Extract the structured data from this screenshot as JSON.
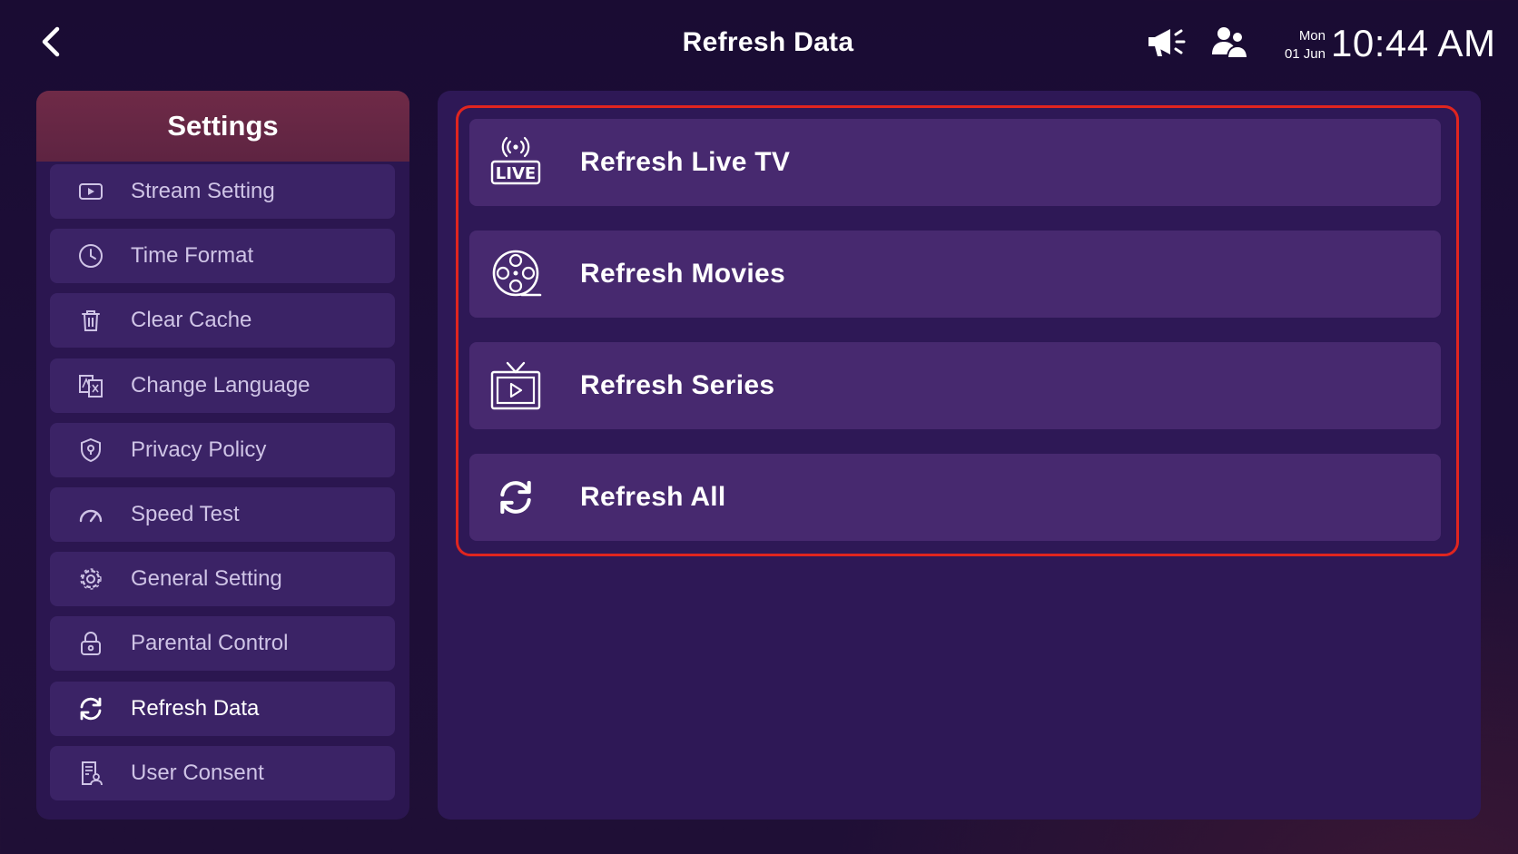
{
  "header": {
    "title": "Refresh Data",
    "date_day": "Mon",
    "date_date": "01 Jun",
    "time": "10:44 AM"
  },
  "icons": {
    "back": "chevron-left-icon",
    "announcement": "megaphone-icon",
    "users": "users-icon"
  },
  "sidebar": {
    "title": "Settings",
    "items": [
      {
        "label": "Stream Setting",
        "icon": "play-icon"
      },
      {
        "label": "Time Format",
        "icon": "clock-icon"
      },
      {
        "label": "Clear Cache",
        "icon": "trash-icon"
      },
      {
        "label": "Change Language",
        "icon": "translate-icon"
      },
      {
        "label": "Privacy Policy",
        "icon": "shield-icon"
      },
      {
        "label": "Speed Test",
        "icon": "speedometer-icon"
      },
      {
        "label": "General Setting",
        "icon": "gear-icon"
      },
      {
        "label": "Parental Control",
        "icon": "lock-icon"
      },
      {
        "label": "Refresh Data",
        "icon": "refresh-icon",
        "active": true
      },
      {
        "label": "User Consent",
        "icon": "document-user-icon"
      }
    ]
  },
  "main": {
    "items": [
      {
        "label": "Refresh Live TV",
        "icon": "live-tv-icon"
      },
      {
        "label": "Refresh Movies",
        "icon": "film-reel-icon"
      },
      {
        "label": "Refresh Series",
        "icon": "tv-play-icon"
      },
      {
        "label": "Refresh All",
        "icon": "refresh-icon"
      }
    ]
  },
  "colors": {
    "accent_red": "#e0251f",
    "sidebar_header": "#6f2a47",
    "item_bg": "#47296f",
    "background": "#1a0c33"
  }
}
